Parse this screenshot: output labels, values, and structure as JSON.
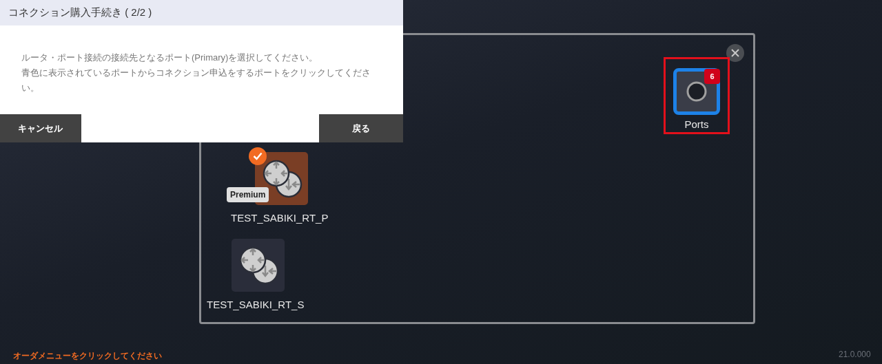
{
  "dialog": {
    "title": "コネクション購入手続き ( 2/2 )",
    "message": [
      "ルータ・ポート接続の接続先となるポート(Primary)を選択してください。",
      "青色に表示されているポートからコネクション申込をするポートをクリックしてください。"
    ],
    "buttons": [
      {
        "kind": "cancel",
        "label": "キャンセル"
      },
      {
        "kind": "back",
        "label": "戻る"
      }
    ]
  },
  "panel": {
    "ports": {
      "label": "Ports",
      "count": "6",
      "highlighted": true
    },
    "routers": [
      {
        "name": "TEST_SABIKI_RT_P",
        "selected": true,
        "tag": "Premium"
      },
      {
        "name": "TEST_SABIKI_RT_S",
        "selected": false
      }
    ]
  },
  "footer": {
    "hint": "オーダメニューをクリックしてください",
    "version": "21.0.000"
  }
}
